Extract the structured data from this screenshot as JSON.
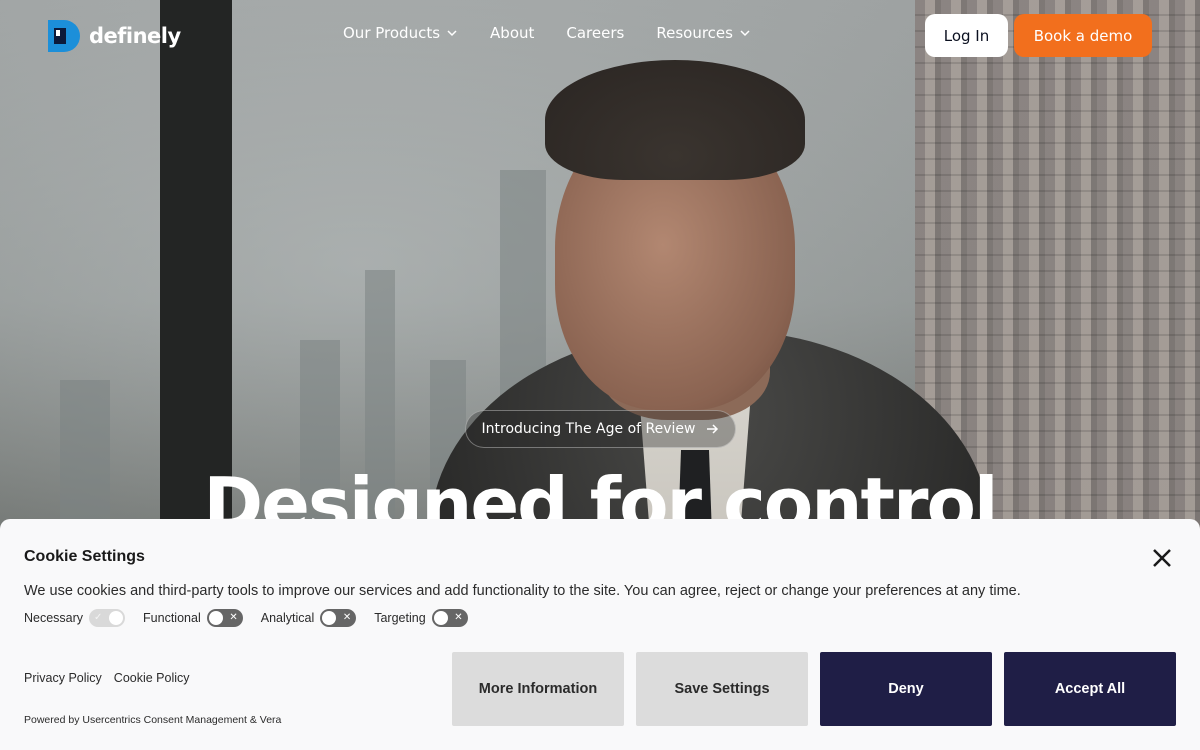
{
  "brand": {
    "name": "definely",
    "accent": "#f26f1d",
    "logo_blue": "#1c8fd9"
  },
  "nav": {
    "items": [
      {
        "label": "Our Products",
        "has_dropdown": true
      },
      {
        "label": "About",
        "has_dropdown": false
      },
      {
        "label": "Careers",
        "has_dropdown": false
      },
      {
        "label": "Resources",
        "has_dropdown": true
      }
    ],
    "login_label": "Log In",
    "demo_label": "Book a demo"
  },
  "hero": {
    "pill_label": "Introducing The Age of Review",
    "pill_icon": "arrow-right-icon",
    "title": "Designed for control"
  },
  "cookie": {
    "title": "Cookie Settings",
    "description": "We use cookies and third-party tools to improve our services and add functionality to the site. You can agree, reject or change your preferences at any time.",
    "toggles": [
      {
        "label": "Necessary",
        "state": "on-locked"
      },
      {
        "label": "Functional",
        "state": "off"
      },
      {
        "label": "Analytical",
        "state": "off"
      },
      {
        "label": "Targeting",
        "state": "off"
      }
    ],
    "links": {
      "privacy": "Privacy Policy",
      "cookie_policy": "Cookie Policy"
    },
    "powered_by": "Powered by Usercentrics Consent Management & Vera",
    "buttons": {
      "more_info": "More Information",
      "save": "Save Settings",
      "deny": "Deny",
      "accept": "Accept All"
    },
    "dark_button_color": "#1f1e46"
  }
}
